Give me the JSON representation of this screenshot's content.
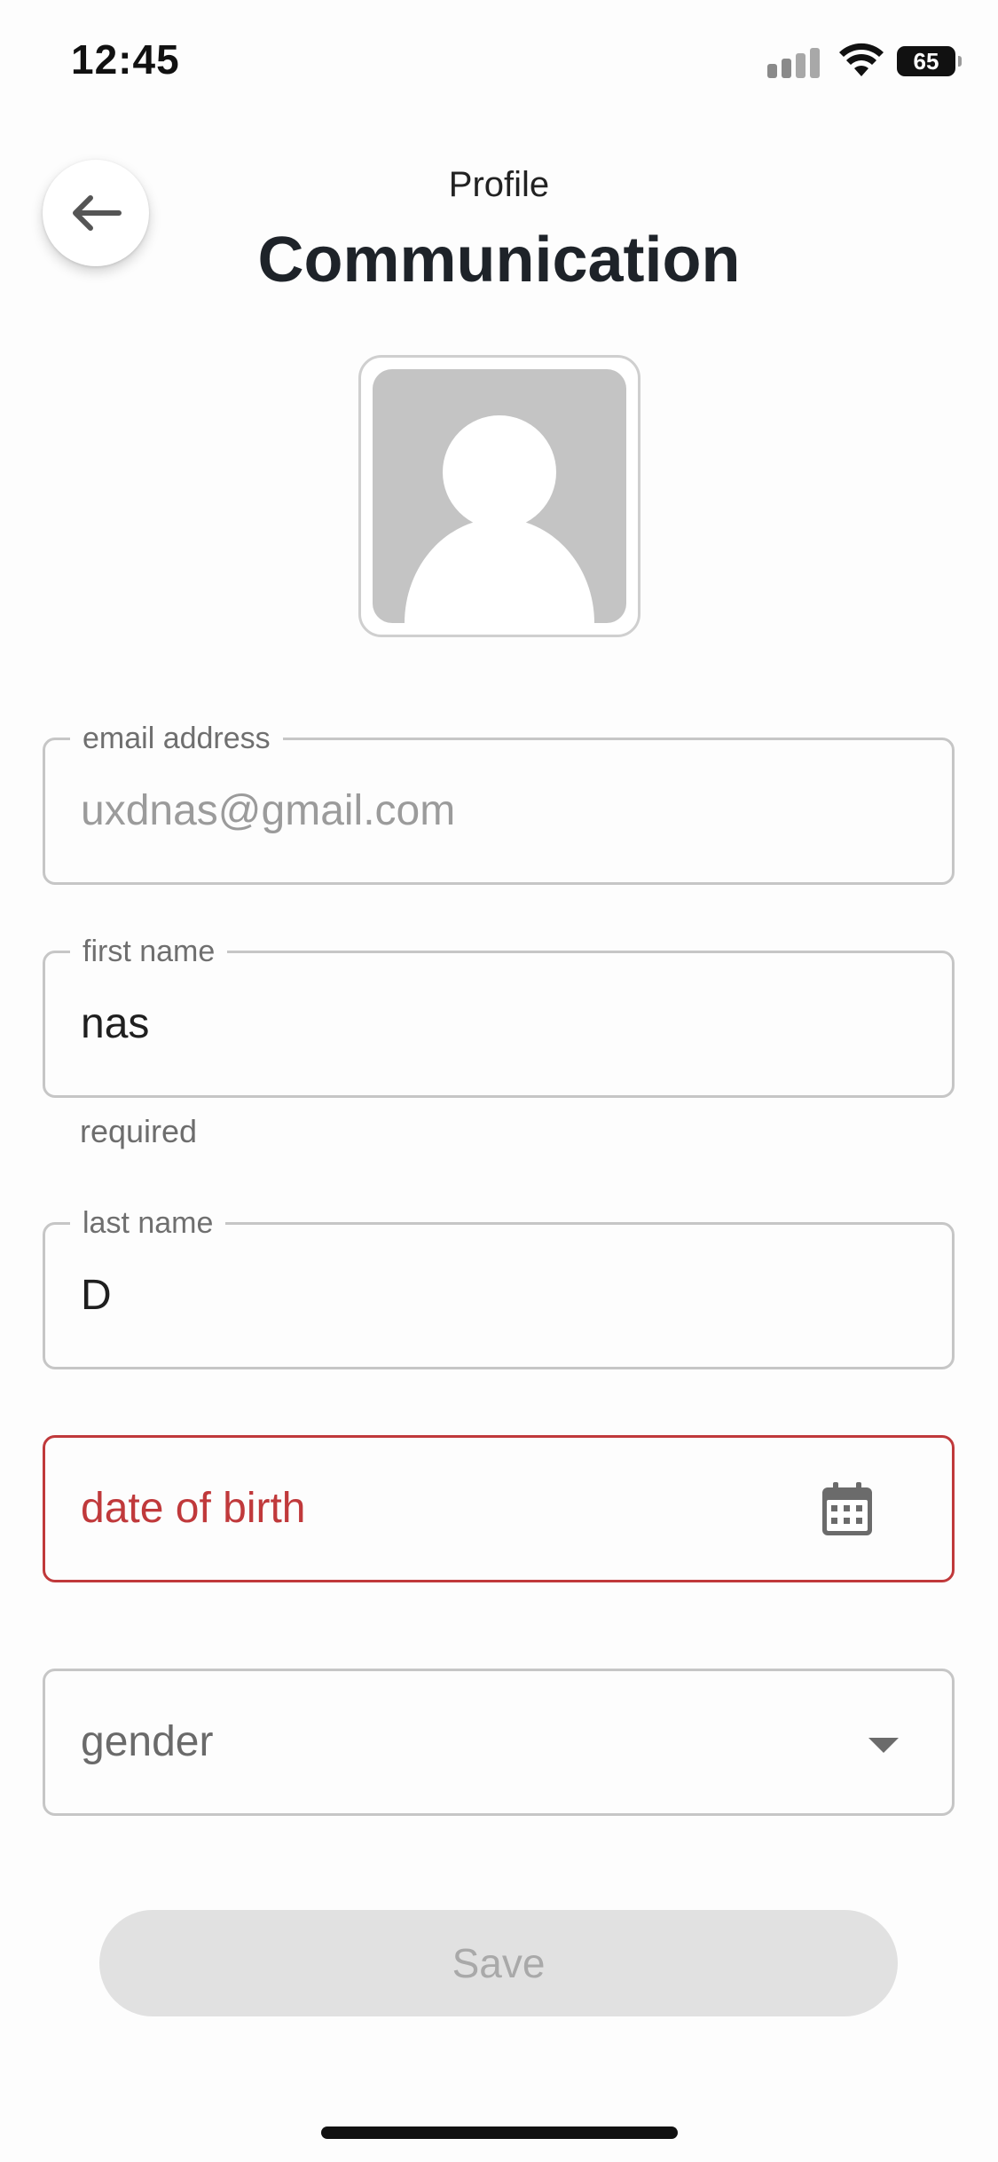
{
  "status_bar": {
    "time": "12:45",
    "battery": "65"
  },
  "header": {
    "subtitle": "Profile",
    "title": "Communication"
  },
  "form": {
    "email": {
      "label": "email address",
      "value": "uxdnas@gmail.com"
    },
    "first_name": {
      "label": "first name",
      "value": "nas",
      "helper": "required"
    },
    "last_name": {
      "label": "last name",
      "value": "D"
    },
    "dob": {
      "placeholder": "date of birth"
    },
    "gender": {
      "placeholder": "gender"
    }
  },
  "actions": {
    "save_label": "Save"
  },
  "colors": {
    "error": "#c0393b",
    "avatar_bg": "#c4c4c4",
    "save_disabled_bg": "#e1e1e1"
  }
}
